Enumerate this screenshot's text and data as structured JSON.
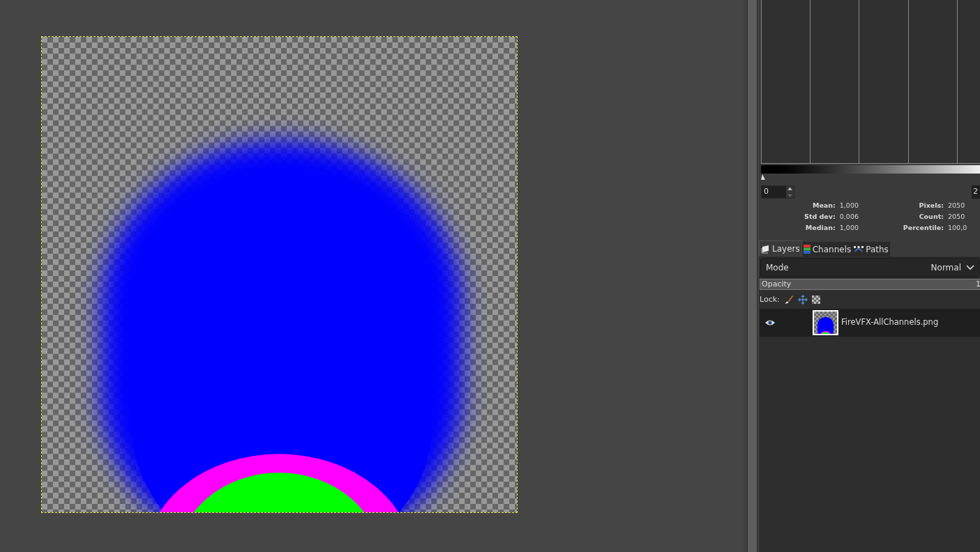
{
  "histogram": {
    "min_value": "0",
    "max_value": "2"
  },
  "statistics": {
    "left": [
      {
        "label": "Mean:",
        "value": "1,000"
      },
      {
        "label": "Std dev:",
        "value": "0,006"
      },
      {
        "label": "Median:",
        "value": "1,000"
      }
    ],
    "right": [
      {
        "label": "Pixels:",
        "value": "2050"
      },
      {
        "label": "Count:",
        "value": "2050"
      },
      {
        "label": "Percentile:",
        "value": "100,0"
      }
    ]
  },
  "tabs": [
    {
      "kind": "layers",
      "label": "Layers",
      "selected": true
    },
    {
      "kind": "channels",
      "label": "Channels",
      "selected": false
    },
    {
      "kind": "paths",
      "label": "Paths",
      "selected": false
    }
  ],
  "mode": {
    "label": "Mode",
    "value": "Normal"
  },
  "opacity": {
    "label": "Opacity",
    "value": "1"
  },
  "lock": {
    "label": "Lock:"
  },
  "layers": [
    {
      "name": "FireVFX-AllChannels.png",
      "visible": true,
      "selected": true
    }
  ]
}
